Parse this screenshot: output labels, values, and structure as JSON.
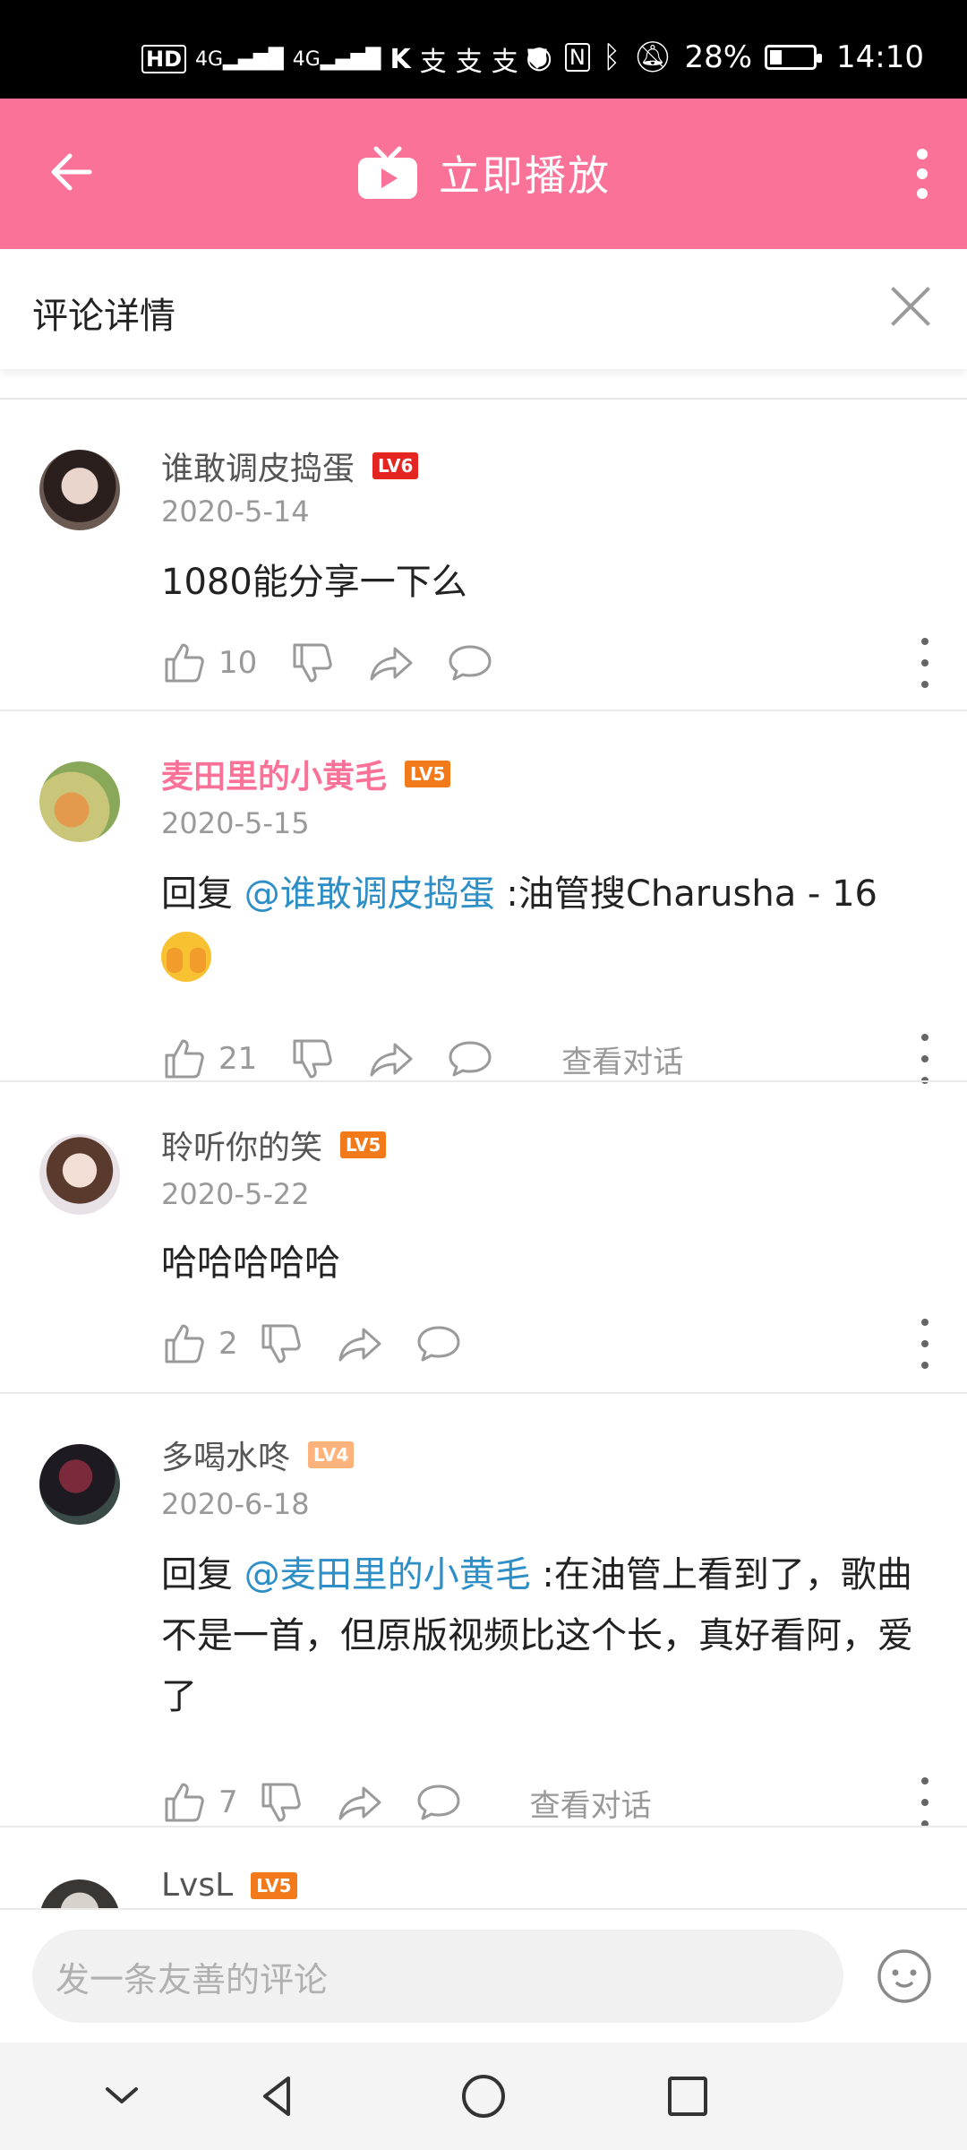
{
  "status_bar": {
    "left_icons": [
      "hd-icon",
      "signal-4g-icon",
      "signal-4g-icon",
      "app-k-icon",
      "alipay-icon",
      "alipay-icon",
      "alipay-icon",
      "shield-icon"
    ],
    "battery": "28%",
    "time": "14:10"
  },
  "app_bar": {
    "title": "立即播放"
  },
  "detail": {
    "title": "评论详情"
  },
  "comments": [
    {
      "username": "谁敢调皮捣蛋",
      "level": "LV6",
      "level_color": "#e52521",
      "date": "2020-5-14",
      "text": "1080能分享一下么",
      "likes": "10",
      "view_conversation": ""
    },
    {
      "username": "麦田里的小黄毛",
      "level": "LV5",
      "level_color": "#f27a1b",
      "date": "2020-5-15",
      "reply_prefix": "回复 ",
      "mention": "@谁敢调皮捣蛋",
      "text": " :油管搜Charusha - 16",
      "likes": "21",
      "view_conversation": "查看对话"
    },
    {
      "username": "聆听你的笑",
      "level": "LV5",
      "level_color": "#f27a1b",
      "date": "2020-5-22",
      "text": "哈哈哈哈哈",
      "likes": "2",
      "view_conversation": ""
    },
    {
      "username": "多喝水咚",
      "level": "LV4",
      "level_color": "#ffb37c",
      "date": "2020-6-18",
      "reply_prefix": "回复 ",
      "mention": "@麦田里的小黄毛",
      "text": " :在油管上看到了，歌曲不是一首，但原版视频比这个长，真好看阿，爱了",
      "likes": "7",
      "view_conversation": "查看对话"
    },
    {
      "username": "LvsL",
      "level": "LV5",
      "level_color": "#f27a1b"
    }
  ],
  "input": {
    "placeholder": "发一条友善的评论"
  }
}
